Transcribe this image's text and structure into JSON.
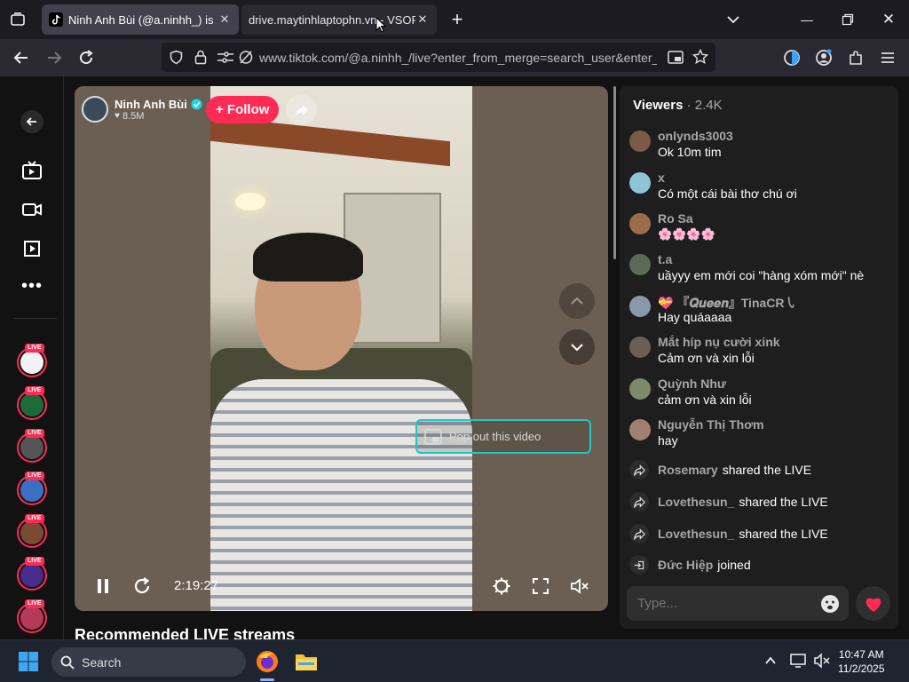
{
  "browser": {
    "tabs": [
      {
        "label": "Ninh Anh Bùi (@a.ninhh_) is LIV",
        "active": true
      },
      {
        "label": "drive.maytinhlaptophn.vn - VSOFTV",
        "active": false
      }
    ],
    "url": "www.tiktok.com/@a.ninhh_/live?enter_from_merge=search_user&enter_m"
  },
  "live": {
    "host_name": "Ninh Anh Bùi",
    "followers": "8.5M",
    "follow_label": "+ Follow",
    "popout_label": "Pop out this video",
    "timecode": "2:19:27",
    "recommended_heading": "Recommended LIVE streams"
  },
  "sidebar": {
    "live_badge": "LIVE"
  },
  "chat": {
    "viewers_label": "Viewers",
    "viewers_count": "· 2.4K",
    "messages": [
      {
        "user": "onlynds3003",
        "text": "Ok 10m tim",
        "avatar_color": "#7a5a48"
      },
      {
        "user": "x",
        "text": "Có một cái bài thơ chú ơi",
        "avatar_color": "#8fc4d8"
      },
      {
        "user": "Ro Sa",
        "text": "🌸🌸🌸🌸",
        "avatar_color": "#9b6b4a"
      },
      {
        "user": "t.a",
        "text": "uầyyy em mới coi \"hàng xóm mới\" nè",
        "avatar_color": "#5a6a55"
      },
      {
        "user": "💝 『𝑸𝒖𝒆𝒆𝒏』TinaCR㇂",
        "text": "Hay quáaaaa",
        "avatar_color": "#8899aa"
      },
      {
        "user": "Mắt híp nụ cười xink",
        "text": "Cảm ơn và xin lỗi",
        "avatar_color": "#6b5e58"
      },
      {
        "user": "Quỳnh Như",
        "text": "cảm ơn và xin lỗi",
        "avatar_color": "#7d8a6a"
      },
      {
        "user": "Nguyễn Thị Thơm",
        "text": "hay",
        "avatar_color": "#a08070"
      }
    ],
    "events": [
      {
        "user": "Rosemary",
        "action": "shared the LIVE",
        "icon": "share-icon"
      },
      {
        "user": "Lovethesun_",
        "action": "shared the LIVE",
        "icon": "share-icon"
      },
      {
        "user": "Lovethesun_",
        "action": "shared the LIVE",
        "icon": "share-icon"
      },
      {
        "user": "Đức Hiệp",
        "action": "joined",
        "icon": "join-icon"
      }
    ],
    "input_placeholder": "Type..."
  },
  "taskbar": {
    "search_label": "Search",
    "time": "10:47 AM",
    "date": "11/2/2025"
  },
  "colors": {
    "accent": "#fe2c55",
    "popout_border": "#1ec7c7",
    "verified": "#20d5ec"
  }
}
